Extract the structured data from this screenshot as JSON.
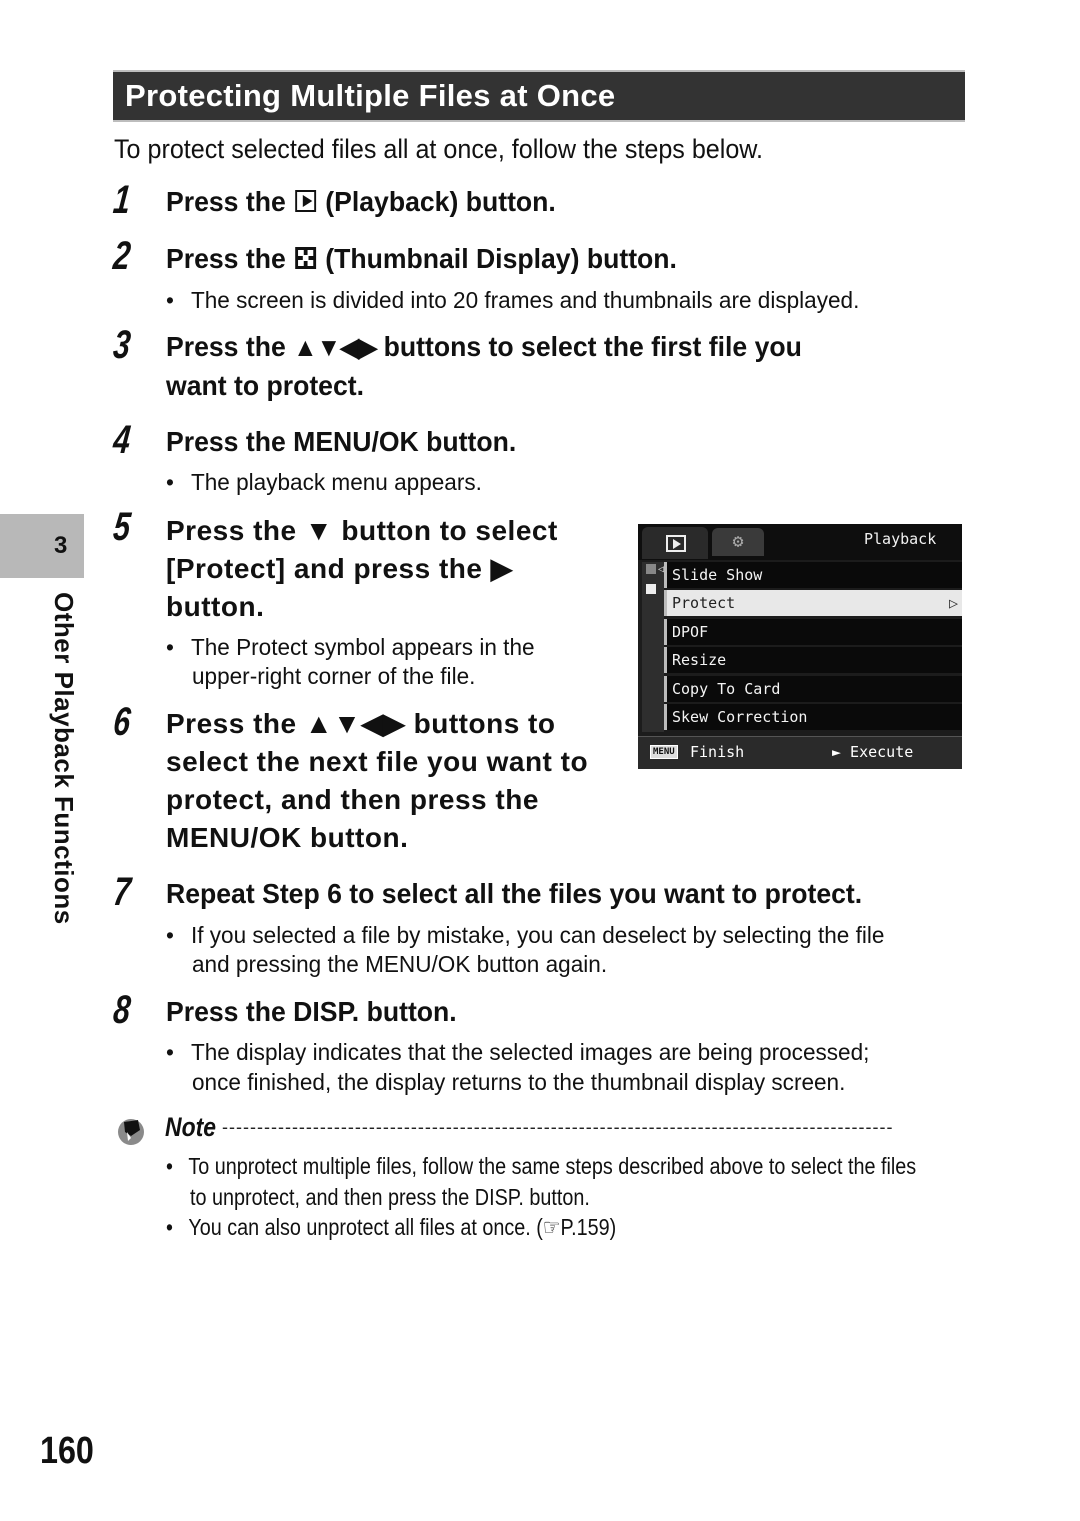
{
  "section": {
    "title": "Protecting Multiple Files at Once",
    "intro": "To protect selected files all at once, follow the steps below."
  },
  "steps": [
    {
      "number": "1",
      "pre": "Press the",
      "icon": "playback-icon",
      "post": "(Playback) button.",
      "bullets": []
    },
    {
      "number": "2",
      "pre": "Press the",
      "icon": "thumbnail-display-icon",
      "post": "(Thumbnail Display) button.",
      "bullets": [
        "The screen is divided into 20 frames and thumbnails are displayed."
      ]
    },
    {
      "number": "3",
      "pre": "Press the",
      "icon": "direction-arrows-icon",
      "arrows": "▲▼◀▶",
      "post": "buttons to select the first file you",
      "line2": "want to protect.",
      "bullets": []
    },
    {
      "number": "4",
      "text": "Press the MENU/OK button.",
      "bullets": [
        "The playback menu appears."
      ]
    },
    {
      "number": "5",
      "pre": "Press the",
      "arrow_down": "▼",
      "post": "button to select",
      "line2_pre": "[Protect] and press the",
      "arrow_right": "▶",
      "line3": "button.",
      "bullets": [
        "The Protect symbol appears in the",
        "upper-right corner of the file."
      ]
    },
    {
      "number": "6",
      "pre": "Press the",
      "arrows": "▲▼◀▶",
      "post": "buttons to",
      "line2": "select the next file you want to",
      "line3": "protect, and then press the",
      "line4": "MENU/OK button.",
      "bullets": []
    },
    {
      "number": "7",
      "text": "Repeat Step 6 to select all the files you want to protect.",
      "bullets": [
        "If you selected a file by mistake, you can deselect by selecting the file",
        "and pressing the MENU/OK button again."
      ]
    },
    {
      "number": "8",
      "text": "Press the DISP. button.",
      "bullets": [
        "The display indicates that the selected images are being processed;",
        "once finished, the display returns to the thumbnail display screen."
      ]
    }
  ],
  "camera_menu": {
    "tab_title": "Playback",
    "tab2_icon": "wrench-icon",
    "items": [
      {
        "label": "Slide Show",
        "selected": false
      },
      {
        "label": "Protect",
        "selected": true
      },
      {
        "label": "DPOF",
        "selected": false
      },
      {
        "label": "Resize",
        "selected": false
      },
      {
        "label": "Copy To Card",
        "selected": false
      },
      {
        "label": "Skew Correction",
        "selected": false
      }
    ],
    "selected_chevron": "▷",
    "footer": {
      "menu_badge": "MENU",
      "finish": "Finish",
      "execute": "► Execute"
    }
  },
  "note": {
    "label": "Note",
    "dashes": "------------------------------------------------------------------------------------------------",
    "bullets": [
      "To unprotect multiple files, follow the same steps described above to select the files",
      "to unprotect, and then press the DISP. button.",
      "You can also unprotect all files at once. (",
      "P.159)"
    ]
  },
  "side_tab": {
    "chapter_number": "3",
    "chapter_label": "Other Playback Functions"
  },
  "page_number": "160",
  "bullet_char": "•"
}
